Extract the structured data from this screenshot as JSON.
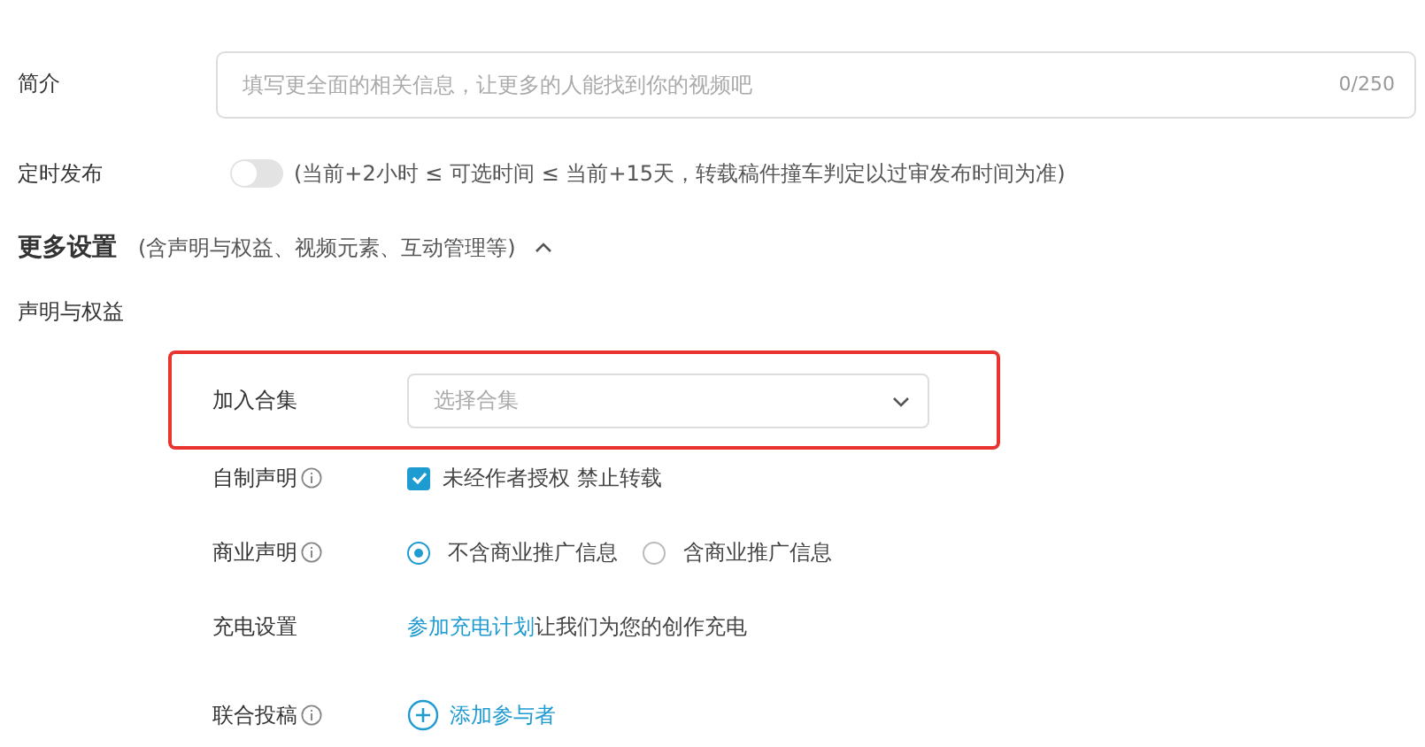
{
  "intro": {
    "label": "简介",
    "placeholder": "填写更全面的相关信息，让更多的人能找到你的视频吧",
    "counter": "0/250"
  },
  "schedule": {
    "label": "定时发布",
    "on": false,
    "note": "(当前+2小时 ≤ 可选时间 ≤ 当前+15天，转载稿件撞车判定以过审发布时间为准)"
  },
  "more": {
    "title": "更多设置",
    "note": "(含声明与权益、视频元素、互动管理等)",
    "expanded": true
  },
  "section_label": "声明与权益",
  "rows": [
    {
      "kind": "select",
      "label": "加入合集",
      "placeholder": "选择合集",
      "highlighted": true
    },
    {
      "kind": "checkbox",
      "label": "自制声明",
      "info": true,
      "checked": true,
      "text": "未经作者授权 禁止转载"
    },
    {
      "kind": "radio",
      "label": "商业声明",
      "info": true,
      "options": [
        {
          "label": "不含商业推广信息",
          "selected": true
        },
        {
          "label": "含商业推广信息",
          "selected": false
        }
      ]
    },
    {
      "kind": "link",
      "label": "充电设置",
      "link": "参加充电计划",
      "text": "让我们为您的创作充电"
    },
    {
      "kind": "add",
      "label": "联合投稿",
      "info": true,
      "action": "添加参与者"
    }
  ]
}
